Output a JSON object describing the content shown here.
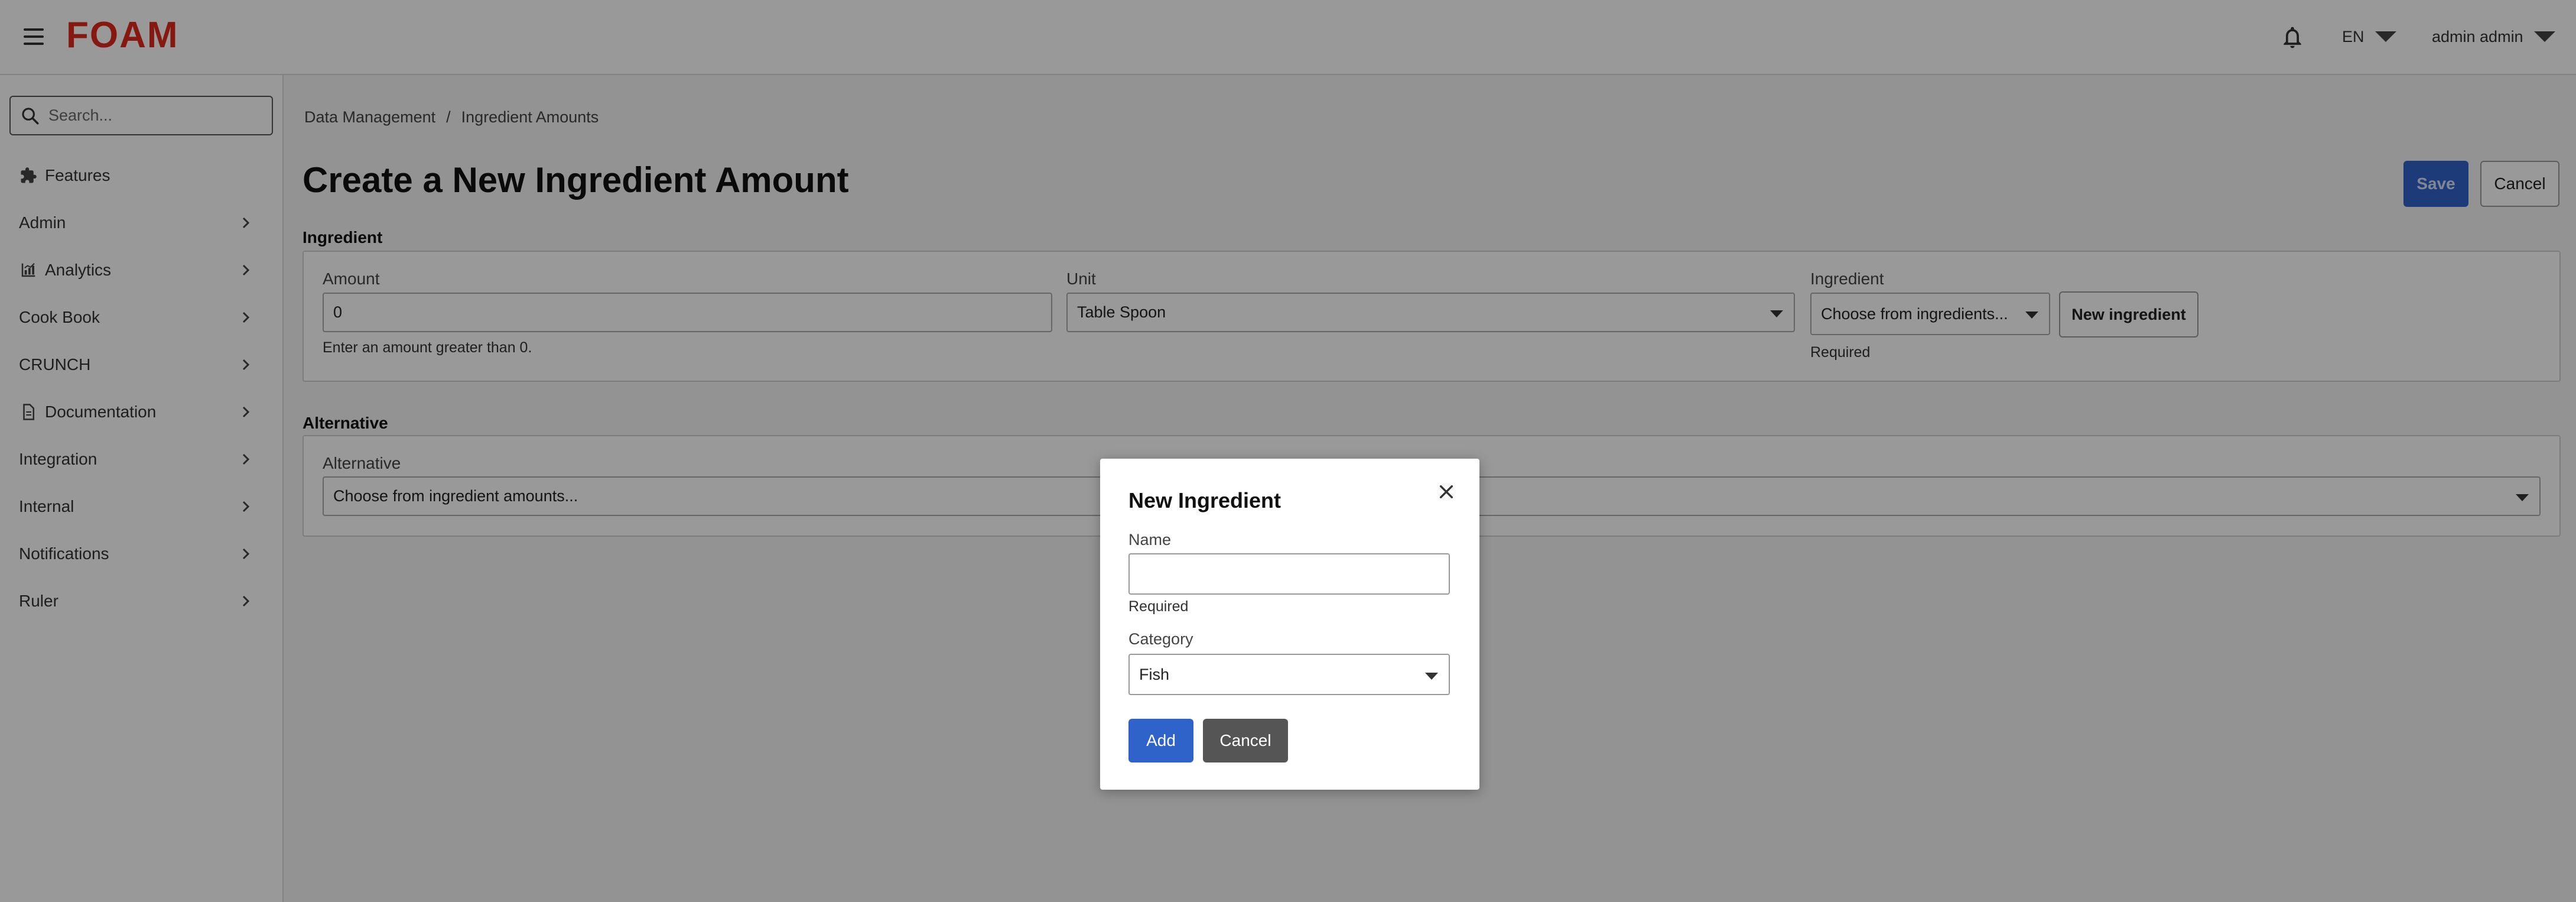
{
  "header": {
    "logo_text": "FOAM",
    "language": "EN",
    "user_name": "admin admin"
  },
  "sidebar": {
    "search_placeholder": "Search...",
    "items": [
      {
        "label": "Features",
        "icon": "puzzle-icon",
        "has_chevron": false
      },
      {
        "label": "Admin",
        "icon": "",
        "has_chevron": true
      },
      {
        "label": "Analytics",
        "icon": "chart-icon",
        "has_chevron": true
      },
      {
        "label": "Cook Book",
        "icon": "",
        "has_chevron": true
      },
      {
        "label": "CRUNCH",
        "icon": "",
        "has_chevron": true
      },
      {
        "label": "Documentation",
        "icon": "document-icon",
        "has_chevron": true
      },
      {
        "label": "Integration",
        "icon": "",
        "has_chevron": true
      },
      {
        "label": "Internal",
        "icon": "",
        "has_chevron": true
      },
      {
        "label": "Notifications",
        "icon": "",
        "has_chevron": true
      },
      {
        "label": "Ruler",
        "icon": "",
        "has_chevron": true
      }
    ]
  },
  "breadcrumb": {
    "items": [
      "Data Management",
      "Ingredient Amounts"
    ],
    "separator": "/"
  },
  "page": {
    "title": "Create a New Ingredient Amount",
    "save_label": "Save",
    "cancel_label": "Cancel"
  },
  "ingredient_section": {
    "label": "Ingredient",
    "amount_label": "Amount",
    "amount_value": "0",
    "amount_helper": "Enter an amount greater than 0.",
    "unit_label": "Unit",
    "unit_value": "Table Spoon",
    "ingredient_label": "Ingredient",
    "ingredient_placeholder": "Choose from ingredients...",
    "ingredient_helper": "Required",
    "new_ingredient_label": "New ingredient"
  },
  "alternative_section": {
    "label": "Alternative",
    "field_label": "Alternative",
    "placeholder": "Choose from ingredient amounts..."
  },
  "modal": {
    "title": "New Ingredient",
    "name_label": "Name",
    "name_value": "",
    "name_helper": "Required",
    "category_label": "Category",
    "category_value": "Fish",
    "add_label": "Add",
    "cancel_label": "Cancel"
  },
  "colors": {
    "brand_red": "#e0281c",
    "primary_blue": "#2f63c9",
    "secondary_gray": "#555555"
  }
}
